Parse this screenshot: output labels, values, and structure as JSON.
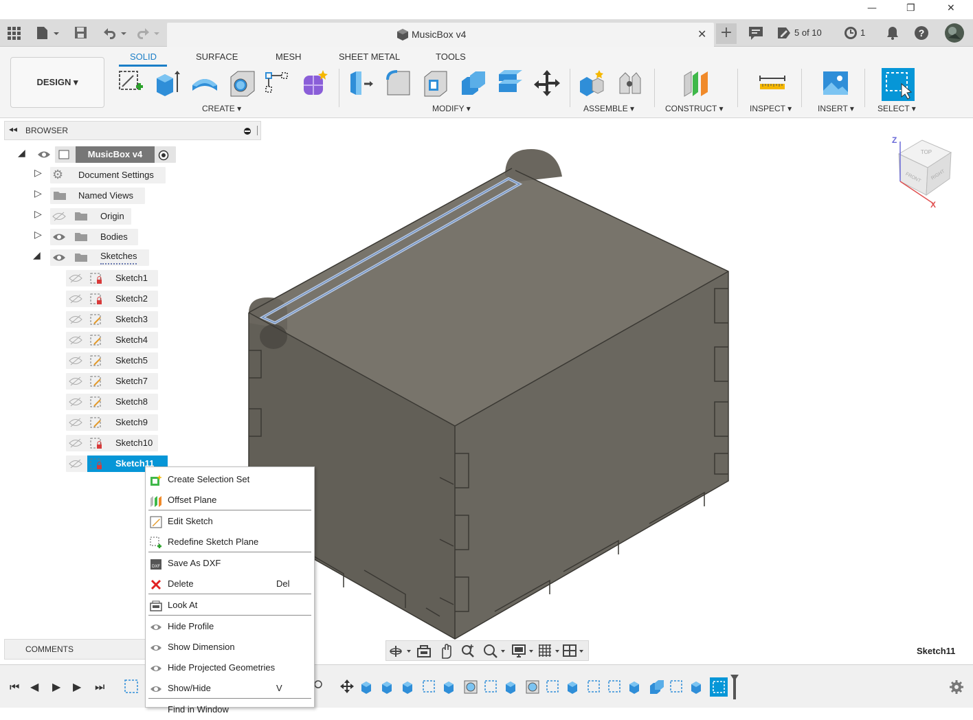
{
  "window": {
    "minimize": "—",
    "restore": "❐",
    "close": "✕"
  },
  "app": {
    "document_title": "MusicBox v4",
    "tab_close": "✕",
    "version_count": "5 of 10",
    "jobs_count": "1"
  },
  "ribbon": {
    "workspace": "DESIGN ▾",
    "tabs": [
      "SOLID",
      "SURFACE",
      "MESH",
      "SHEET METAL",
      "TOOLS"
    ],
    "groups": [
      "CREATE ▾",
      "MODIFY ▾",
      "ASSEMBLE ▾",
      "CONSTRUCT ▾",
      "INSPECT ▾",
      "INSERT ▾",
      "SELECT ▾"
    ]
  },
  "browser": {
    "title": "BROWSER",
    "root": "MusicBox v4",
    "folders": [
      "Document Settings",
      "Named Views",
      "Origin",
      "Bodies",
      "Sketches"
    ],
    "sketches": [
      "Sketch1",
      "Sketch2",
      "Sketch3",
      "Sketch4",
      "Sketch5",
      "Sketch7",
      "Sketch8",
      "Sketch9",
      "Sketch10",
      "Sketch11"
    ]
  },
  "context_menu": {
    "items": [
      {
        "label": "Create Selection Set",
        "shortcut": ""
      },
      {
        "label": "Offset Plane",
        "shortcut": ""
      },
      {
        "label": "Edit Sketch",
        "shortcut": ""
      },
      {
        "label": "Redefine Sketch Plane",
        "shortcut": ""
      },
      {
        "label": "Save As DXF",
        "shortcut": ""
      },
      {
        "label": "Delete",
        "shortcut": "Del"
      },
      {
        "label": "Look At",
        "shortcut": ""
      },
      {
        "label": "Hide Profile",
        "shortcut": ""
      },
      {
        "label": "Show Dimension",
        "shortcut": ""
      },
      {
        "label": "Hide Projected Geometries",
        "shortcut": ""
      },
      {
        "label": "Show/Hide",
        "shortcut": "V"
      },
      {
        "label": "Find in Window",
        "shortcut": ""
      }
    ]
  },
  "comments": {
    "title": "COMMENTS"
  },
  "status": {
    "selection": "Sketch11"
  },
  "viewcube": {
    "top": "TOP",
    "front": "FRONT",
    "right": "RIGHT",
    "z": "Z",
    "x": "X"
  },
  "colors": {
    "accent": "#0696d7",
    "body": "#6e6a62",
    "selected": "#1a8fd8"
  },
  "icons": {
    "delete": "red-x-icon",
    "settings": "gear-icon"
  }
}
